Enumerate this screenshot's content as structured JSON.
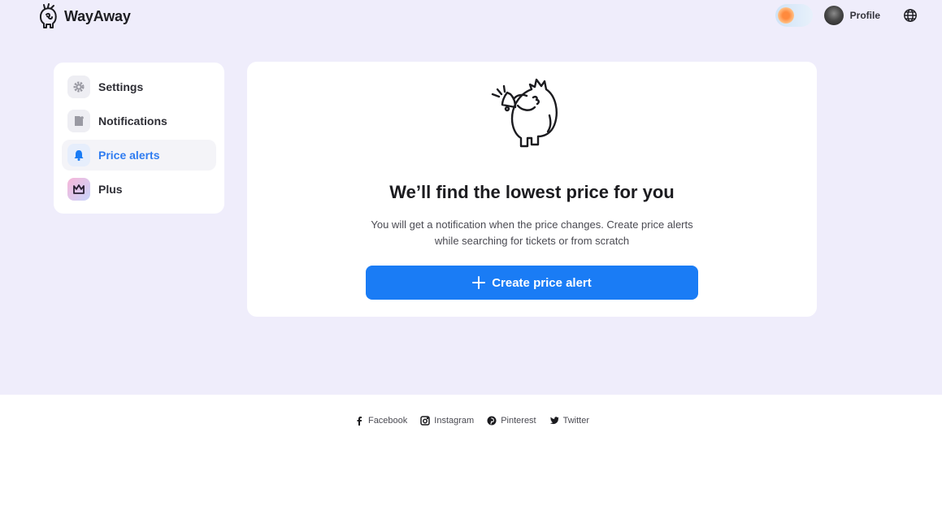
{
  "header": {
    "brand": "WayAway",
    "profile_label": "Profile",
    "icons": {
      "logo": "mascot-logo-icon",
      "theme_toggle": "theme-toggle",
      "avatar": "avatar",
      "language": "globe-icon"
    }
  },
  "sidebar": {
    "items": [
      {
        "label": "Settings",
        "icon": "gear-icon",
        "active": false
      },
      {
        "label": "Notifications",
        "icon": "notification-icon",
        "active": false
      },
      {
        "label": "Price alerts",
        "icon": "bell-icon",
        "active": true
      },
      {
        "label": "Plus",
        "icon": "crown-icon",
        "active": false
      }
    ]
  },
  "main": {
    "title": "We’ll find the lowest price for you",
    "description": "You will get a notification when the price changes. Create price alerts while searching for tickets or from scratch",
    "cta_label": "Create price alert",
    "accent_color": "#1a7cf5"
  },
  "footer": {
    "links": [
      {
        "label": "Facebook",
        "icon": "facebook-icon"
      },
      {
        "label": "Instagram",
        "icon": "instagram-icon"
      },
      {
        "label": "Pinterest",
        "icon": "pinterest-icon"
      },
      {
        "label": "Twitter",
        "icon": "twitter-icon"
      }
    ]
  }
}
